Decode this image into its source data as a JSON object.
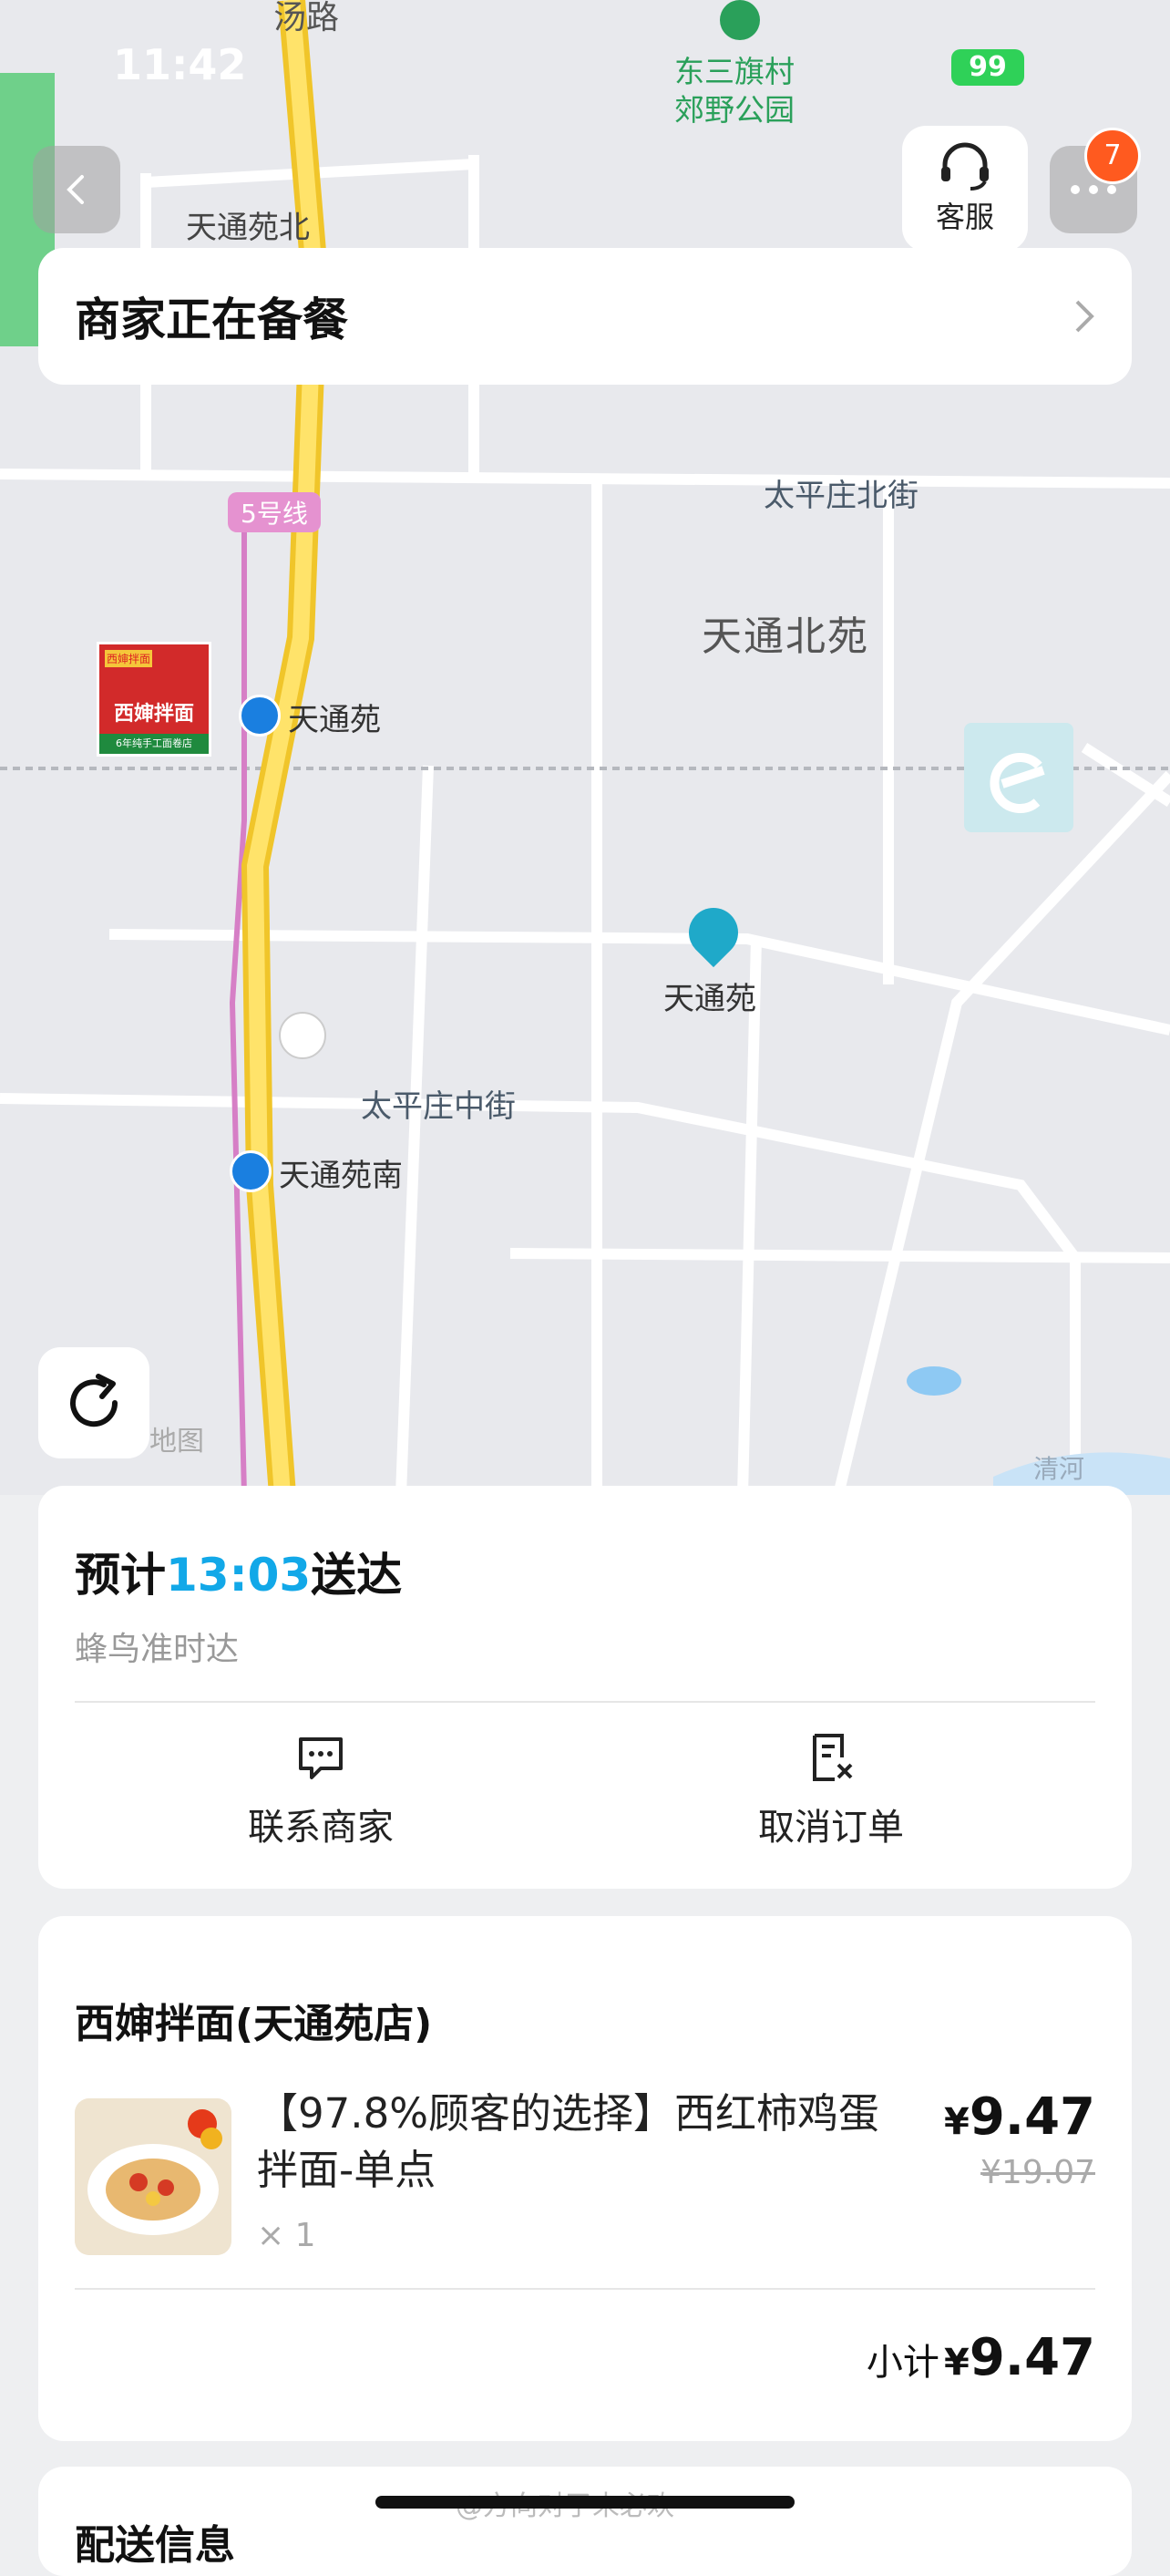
{
  "status_bar": {
    "time": "11:42",
    "battery": "99"
  },
  "map": {
    "labels": {
      "road_vertical": "汤路",
      "park": "东三旗村\n郊野公园",
      "tiantongyuan_north": "天通苑北",
      "line5": "5号线",
      "taipingzhuang_north_st": "太平庄北街",
      "tiantong_beiyuan": "天通北苑",
      "station_tiantongyuan": "天通苑",
      "poi_tiantongyuan": "天通苑",
      "taipingzhuang_middle_st": "太平庄中街",
      "station_tiantongyuan_south": "天通苑南",
      "map_provider": "地图",
      "qinghe": "清河"
    },
    "merchant_sign": {
      "name": "西婶拌面",
      "tagline": "6年纯手工面卷店",
      "corner": "西婶拌面"
    }
  },
  "top_actions": {
    "customer_service": "客服",
    "more_badge": "7"
  },
  "status_card": {
    "title": "商家正在备餐"
  },
  "eta_card": {
    "prefix": "预计",
    "time": "13:03",
    "suffix": "送达",
    "sub": "蜂鸟准时达",
    "contact_label": "联系商家",
    "cancel_label": "取消订单"
  },
  "order_card": {
    "shop": "西婶拌面(天通苑店)",
    "item_name": "【97.8%顾客的选择】西红柿鸡蛋拌面-单点",
    "qty": "× 1",
    "currency": "¥",
    "price": "9.47",
    "original_price": "¥19.07",
    "subtotal_label": "小计",
    "subtotal": "9.47"
  },
  "next_card": {
    "title": "配送信息"
  },
  "watermark": "@方向对了未必欢"
}
